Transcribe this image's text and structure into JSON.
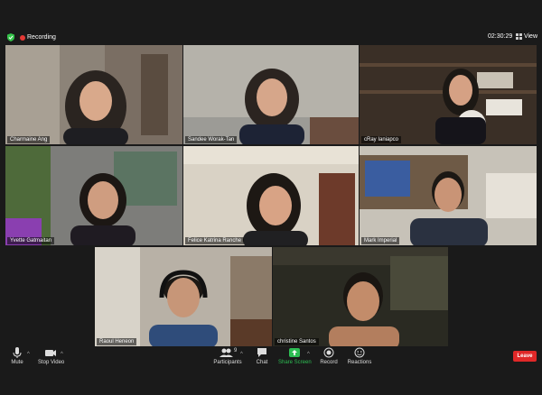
{
  "colors": {
    "background": "#1a1a1a",
    "active_speaker_border": "#c9e03a",
    "recording_dot": "#e53935",
    "security_shield": "#35c24a",
    "share_screen_green": "#2dbd53",
    "leave_red": "#e02828"
  },
  "header": {
    "recording_label": "Recording",
    "security_icon": "shield-check-icon",
    "timer": "02:30:29",
    "view_label": "View"
  },
  "participants": [
    {
      "name": "Charmaine Ang"
    },
    {
      "name": "Sandee Worak-Tan"
    },
    {
      "name": "cRay Ianiapco"
    },
    {
      "name": "Yvette Gatmaitan"
    },
    {
      "name": "Felice Katrina Ranche"
    },
    {
      "name": "Mark Imperial"
    },
    {
      "name": "Raoul Heneon"
    },
    {
      "name": "christine Santos"
    }
  ],
  "toolbar": {
    "mute_label": "Mute",
    "stop_video_label": "Stop Video",
    "participants_label": "Participants",
    "participants_count": "9",
    "chat_label": "Chat",
    "share_screen_label": "Share Screen",
    "record_label": "Record",
    "reactions_label": "Reactions",
    "leave_label": "Leave"
  }
}
